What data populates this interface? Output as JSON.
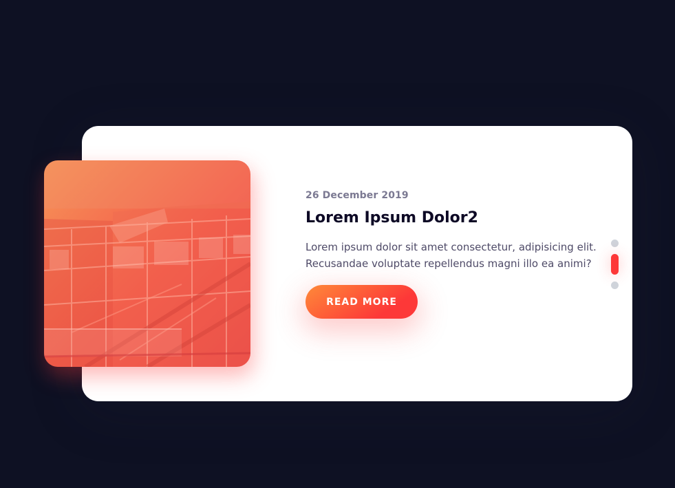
{
  "slide": {
    "date": "26 December 2019",
    "title": "Lorem Ipsum Dolor2",
    "text_line1": "Lorem ipsum dolor sit amet consectetur, adipisicing elit.",
    "text_line2": "Recusandae voluptate repellendus magni illo ea animi?",
    "button_label": "READ MORE"
  },
  "pagination": {
    "count": 3,
    "active_index": 1
  },
  "colors": {
    "background": "#0e1123",
    "card": "#ffffff",
    "accent_start": "#fe8a39",
    "accent_end": "#fd3838",
    "bullet_inactive": "#cfd3da"
  },
  "image": {
    "description_icon": "building-photo"
  }
}
